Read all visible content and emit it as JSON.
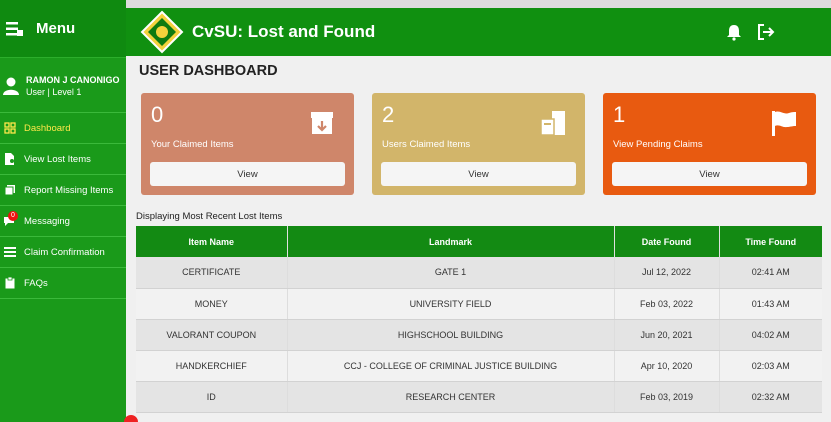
{
  "sidebar": {
    "menu_label": "Menu",
    "user_name": "RAMON J CANONIGO",
    "user_role": "User | Level 1",
    "items": [
      {
        "label": "Dashboard"
      },
      {
        "label": "View Lost Items"
      },
      {
        "label": "Report Missing Items"
      },
      {
        "label": "Messaging",
        "badge": "0"
      },
      {
        "label": "Claim Confirmation"
      },
      {
        "label": "FAQs"
      }
    ]
  },
  "header": {
    "title": "CvSU: Lost and Found"
  },
  "main": {
    "page_title": "USER DASHBOARD",
    "cards": [
      {
        "count": "0",
        "label": "Your Claimed Items",
        "button": "View",
        "color": "#cf866a"
      },
      {
        "count": "2",
        "label": "Users Claimed Items",
        "button": "View",
        "color": "#d2b56a"
      },
      {
        "count": "1",
        "label": "View Pending Claims",
        "button": "View",
        "color": "#e85a10"
      }
    ],
    "table_caption": "Displaying Most Recent Lost Items",
    "table": {
      "headers": [
        "Item Name",
        "Landmark",
        "Date Found",
        "Time Found"
      ],
      "rows": [
        [
          "CERTIFICATE",
          "GATE 1",
          "Jul 12, 2022",
          "02:41 AM"
        ],
        [
          "MONEY",
          "UNIVERSITY FIELD",
          "Feb 03, 2022",
          "01:43 AM"
        ],
        [
          "VALORANT COUPON",
          "HIGHSCHOOL BUILDING",
          "Jun 20, 2021",
          "04:02 AM"
        ],
        [
          "HANDKERCHIEF",
          "CCJ - COLLEGE OF CRIMINAL JUSTICE BUILDING",
          "Apr 10, 2020",
          "02:03 AM"
        ],
        [
          "ID",
          "RESEARCH CENTER",
          "Feb 03, 2019",
          "02:32 AM"
        ]
      ]
    }
  },
  "colors": {
    "sidebar": "#1a9a1a",
    "topbar": "#109010",
    "table_header": "#138a13",
    "active_nav": "#ffe84a"
  },
  "icons": {
    "menu": "hamburger-icon",
    "user": "user-icon",
    "bell": "bell-icon",
    "logout": "logout-icon"
  }
}
